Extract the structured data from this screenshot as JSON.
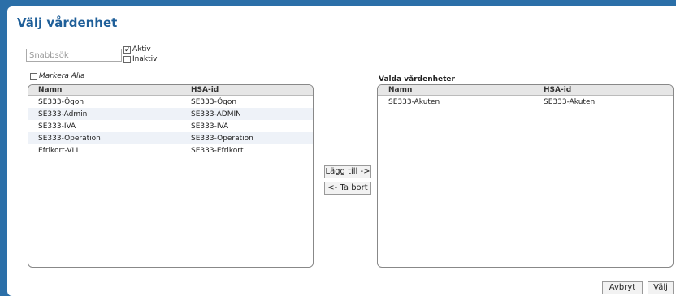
{
  "title": "Välj vårdenhet",
  "search": {
    "placeholder": "Snabbsök"
  },
  "filters": {
    "aktiv": {
      "label": "Aktiv",
      "checked": true
    },
    "inaktiv": {
      "label": "Inaktiv",
      "checked": false
    }
  },
  "markera_alla": {
    "label": "Markera Alla",
    "checked": false
  },
  "available": {
    "headers": [
      "Namn",
      "HSA-id"
    ],
    "rows": [
      [
        "SE333-Ögon",
        "SE333-Ögon"
      ],
      [
        "SE333-Admin",
        "SE333-ADMIN"
      ],
      [
        "SE333-IVA",
        "SE333-IVA"
      ],
      [
        "SE333-Operation",
        "SE333-Operation"
      ],
      [
        "Efrikort-VLL",
        "SE333-Efrikort"
      ]
    ]
  },
  "selected": {
    "label": "Valda vårdenheter",
    "headers": [
      "Namn",
      "HSA-id"
    ],
    "rows": [
      [
        "SE333-Akuten",
        "SE333-Akuten"
      ]
    ]
  },
  "buttons": {
    "add": "Lägg till ->",
    "remove": "<- Ta bort",
    "cancel": "Avbryt",
    "ok": "Välj"
  },
  "colors": {
    "accent": "#1f5f99",
    "frame": "#2b6fa8"
  }
}
